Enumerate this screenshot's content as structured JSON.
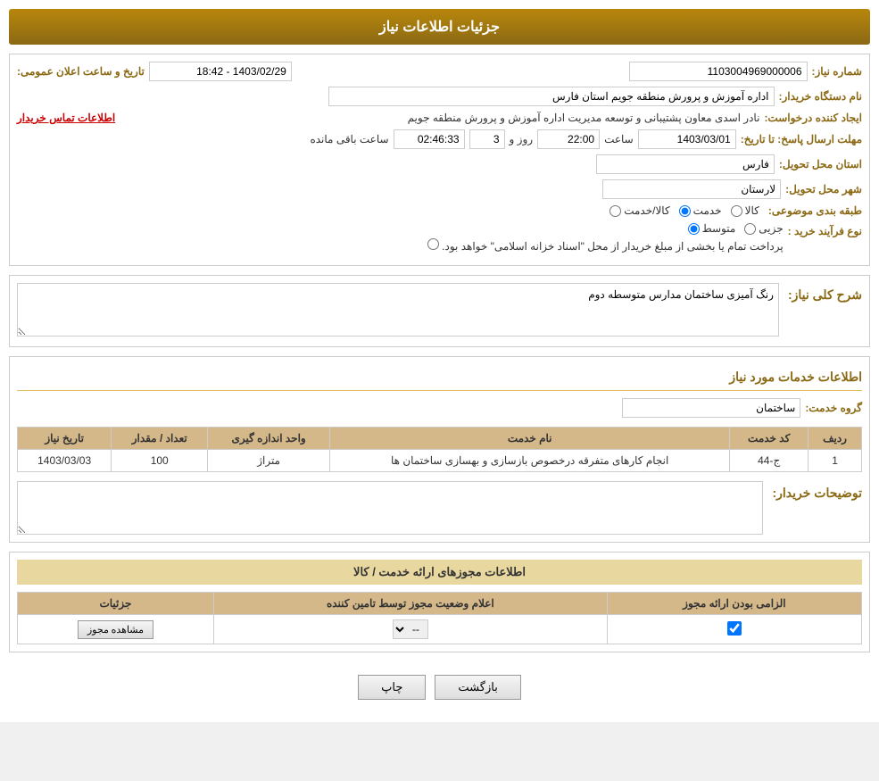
{
  "header": {
    "title": "جزئیات اطلاعات نیاز"
  },
  "fields": {
    "need_number_label": "شماره نیاز:",
    "need_number_value": "1103004969000006",
    "date_label": "تاریخ و ساعت اعلان عمومی:",
    "date_value": "1403/02/29 - 18:42",
    "buyer_org_label": "نام دستگاه خریدار:",
    "buyer_org_value": "اداره آموزش و پرورش منطقه جویم استان فارس",
    "creator_label": "ایجاد کننده درخواست:",
    "creator_value": "نادر اسدی معاون پشتیبانی و توسعه مدیریت اداره آموزش و پرورش منطقه جویم",
    "contact_info_link": "اطلاعات تماس خریدار",
    "deadline_label": "مهلت ارسال پاسخ: تا تاریخ:",
    "deadline_date": "1403/03/01",
    "deadline_time_label": "ساعت",
    "deadline_time": "22:00",
    "deadline_day_label": "روز و",
    "deadline_days": "3",
    "deadline_remaining_label": "ساعت باقی مانده",
    "deadline_remaining": "02:46:33",
    "province_label": "استان محل تحویل:",
    "province_value": "فارس",
    "city_label": "شهر محل تحویل:",
    "city_value": "لارستان",
    "category_label": "طبقه بندی موضوعی:",
    "category_options": [
      "کالا",
      "خدمت",
      "کالا/خدمت"
    ],
    "category_selected": "خدمت",
    "purchase_type_label": "نوع فرآیند خرید :",
    "purchase_type_options": [
      "جزیی",
      "متوسط",
      "پرداخت تمام یا بخشی از مبلغ خریدار از محل \"اسناد خزانه اسلامی\" خواهد بود."
    ],
    "purchase_type_selected": "متوسط",
    "need_desc_label": "شرح کلی نیاز:",
    "need_desc_value": "رنگ آمیزی ساختمان مدارس متوسطه دوم",
    "services_section_title": "اطلاعات خدمات مورد نیاز",
    "service_group_label": "گروه خدمت:",
    "service_group_value": "ساختمان",
    "table_headers": [
      "ردیف",
      "کد خدمت",
      "نام خدمت",
      "واحد اندازه گیری",
      "تعداد / مقدار",
      "تاریخ نیاز"
    ],
    "table_rows": [
      {
        "row": "1",
        "code": "ج-44",
        "name": "انجام کارهای متفرقه درخصوص بازسازی و بهسازی ساختمان ها",
        "unit": "متراژ",
        "quantity": "100",
        "date": "1403/03/03"
      }
    ],
    "buyer_notes_label": "توضیحات خریدار:",
    "buyer_notes_value": "",
    "licenses_section_title": "اطلاعات مجوزهای ارائه خدمت / کالا",
    "license_table_headers": [
      "الزامی بودن ارائه مجوز",
      "اعلام وضعیت مجوز توسط نامین کننده",
      "جزئیات"
    ],
    "license_row": {
      "required": true,
      "status": "--",
      "details_btn": "مشاهده مجوز"
    }
  },
  "buttons": {
    "print": "چاپ",
    "back": "بازگشت"
  }
}
